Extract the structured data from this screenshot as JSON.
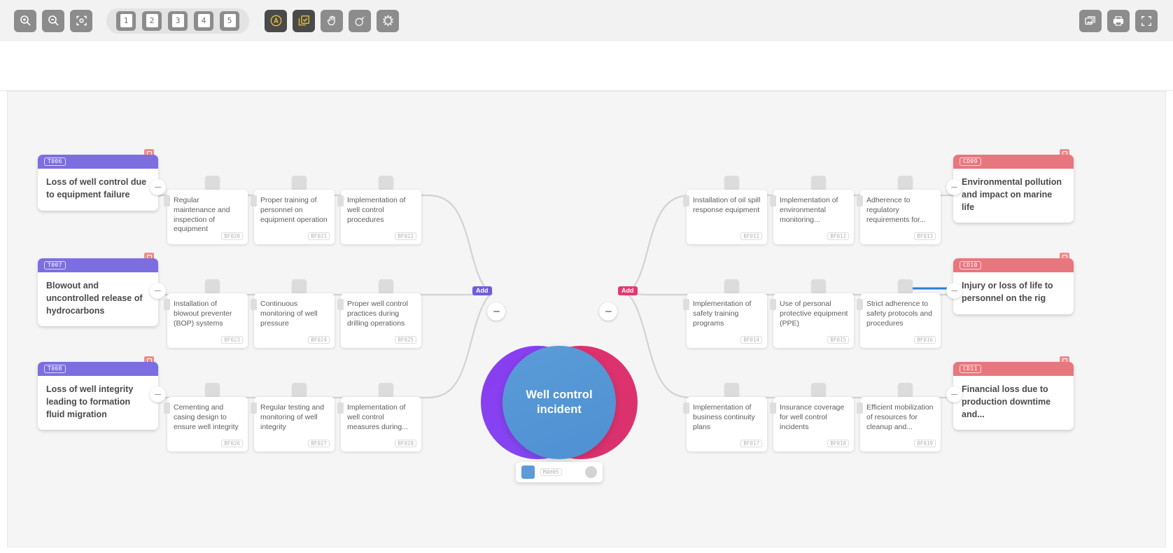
{
  "toolbar": {
    "left_buttons": [
      {
        "name": "zoom-in-icon",
        "label": "Zoom in"
      },
      {
        "name": "zoom-out-icon",
        "label": "Zoom out"
      },
      {
        "name": "fit-to-screen-icon",
        "label": "Fit to screen"
      }
    ],
    "page_buttons": [
      {
        "label": "1"
      },
      {
        "label": "2"
      },
      {
        "label": "3"
      },
      {
        "label": "4"
      },
      {
        "label": "5"
      }
    ],
    "mode_buttons": [
      {
        "name": "activity-icon",
        "label": "A",
        "active": true
      },
      {
        "name": "checklist-icon",
        "label": "Checklist",
        "active": true
      },
      {
        "name": "hand-icon",
        "label": "Hand"
      },
      {
        "name": "bomb-icon",
        "label": "Hazard"
      },
      {
        "name": "explosion-icon",
        "label": "Explosion"
      }
    ],
    "right_buttons": [
      {
        "name": "image-export-icon",
        "label": "Export image"
      },
      {
        "name": "print-icon",
        "label": "Print"
      },
      {
        "name": "fullscreen-icon",
        "label": "Fullscreen"
      }
    ]
  },
  "hazard": {
    "title": "Well control incident",
    "code": "MAH05",
    "add_left_label": "Add",
    "add_right_label": "Add"
  },
  "colors": {
    "threat_header": "#7c6ee0",
    "consequence_header": "#e8767e",
    "hazard_left": "#8b3bf0",
    "hazard_right": "#e0316f",
    "hazard_center": "#5b9bd8",
    "highlight_line": "#2b7fd4"
  },
  "threats": [
    {
      "code": "T006",
      "title": "Loss of well control due to equipment failure"
    },
    {
      "code": "T007",
      "title": "Blowout and uncontrolled release of hydrocarbons"
    },
    {
      "code": "T008",
      "title": "Loss of well integrity leading to formation fluid migration"
    }
  ],
  "consequences": [
    {
      "code": "CD09",
      "title": "Environmental pollution and impact on marine life"
    },
    {
      "code": "CD10",
      "title": "Injury or loss of life to personnel on the rig"
    },
    {
      "code": "CD11",
      "title": "Financial loss due to production downtime and..."
    }
  ],
  "preventive_barriers": [
    [
      {
        "text": "Regular maintenance and inspection of equipment",
        "code": "BF020"
      },
      {
        "text": "Proper training of personnel on equipment operation",
        "code": "BF021"
      },
      {
        "text": "Implementation of well control procedures",
        "code": "BF022"
      }
    ],
    [
      {
        "text": "Installation of blowout preventer (BOP) systems",
        "code": "BF023"
      },
      {
        "text": "Continuous monitoring of well pressure",
        "code": "BF024"
      },
      {
        "text": "Proper well control practices during drilling operations",
        "code": "BF025"
      }
    ],
    [
      {
        "text": "Cementing and casing design to ensure well integrity",
        "code": "BF026"
      },
      {
        "text": "Regular testing and monitoring of well integrity",
        "code": "BF027"
      },
      {
        "text": "Implementation of well control measures during...",
        "code": "BF028"
      }
    ]
  ],
  "mitigative_barriers": [
    [
      {
        "text": "Installation of oil spill response equipment",
        "code": "BF011"
      },
      {
        "text": "Implementation of environmental monitoring...",
        "code": "BF012"
      },
      {
        "text": "Adherence to regulatory requirements for...",
        "code": "BF013"
      }
    ],
    [
      {
        "text": "Implementation of safety training programs",
        "code": "BF014"
      },
      {
        "text": "Use of personal protective equipment (PPE)",
        "code": "BF015"
      },
      {
        "text": "Strict adherence to safety protocols and procedures",
        "code": "BF016"
      }
    ],
    [
      {
        "text": "Implementation of business continuity plans",
        "code": "BF017"
      },
      {
        "text": "Insurance coverage for well control incidents",
        "code": "BF018"
      },
      {
        "text": "Efficient mobilization of resources for cleanup and...",
        "code": "BF019"
      }
    ]
  ]
}
